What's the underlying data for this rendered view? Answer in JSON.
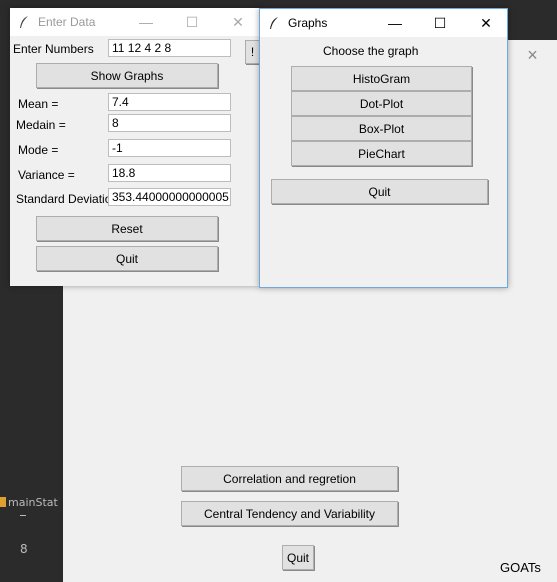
{
  "background": {
    "sidebar_label": "mainStat",
    "sidebar_number": "8",
    "close_glyph": "×"
  },
  "main": {
    "correlation_button": "Correlation and regretion",
    "central_tendency_button": "Central Tendency and Variability",
    "quit_button": "Quit",
    "corner_text": "GOATs"
  },
  "enter_data_window": {
    "title": "Enter Data",
    "edge_button": "!",
    "numbers_label": "Enter Numbers",
    "numbers_value": "11  12 4 2 8",
    "show_graphs_button": "Show Graphs",
    "mean_label": "Mean   =",
    "mean_value": "7.4",
    "median_label": "Medain =",
    "median_value": "8",
    "mode_label": "Mode   =",
    "mode_value": "-1",
    "variance_label": "Variance   =",
    "variance_value": "18.8",
    "std_label": "Standard Deviatio",
    "std_value": "353.44000000000005",
    "reset_button": "Reset",
    "quit_button": "Quit"
  },
  "graphs_window": {
    "title": "Graphs",
    "prompt": "Choose the graph",
    "histogram_button": "HistoGram",
    "dotplot_button": "Dot-Plot",
    "boxplot_button": "Box-Plot",
    "piechart_button": "PieChart",
    "quit_button": "Quit"
  },
  "titlebar_controls": {
    "minimize": "—",
    "maximize": "☐",
    "close": "✕"
  }
}
